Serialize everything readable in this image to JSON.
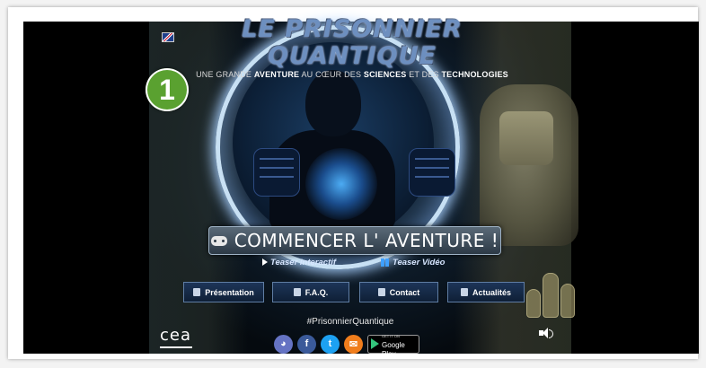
{
  "site": {
    "title": "LE PRISONNIER QUANTIQUE",
    "tagline_parts": [
      "UNE GRANDE ",
      "AVENTURE",
      " AU CŒUR DES ",
      "SCIENCES",
      " ET DES ",
      "TECHNOLOGIES"
    ],
    "language_flag": "uk-flag-icon"
  },
  "badge": {
    "number": "1",
    "color": "#5aa130"
  },
  "cta": {
    "label": "COMMENCER L' AVENTURE !",
    "icon": "gamepad-icon"
  },
  "teasers": {
    "interactive": "Teaser interactif",
    "video": "Teaser Vidéo"
  },
  "nav": {
    "presentation": "Présentation",
    "faq": "F.A.Q.",
    "contact": "Contact",
    "news": "Actualités"
  },
  "footer": {
    "hashtag": "#PrisonnierQuantique",
    "logo_text": "cea",
    "google_play_small": "GET IT ON",
    "google_play_big": "Google Play",
    "social_icons": [
      "discord-icon",
      "facebook-icon",
      "twitter-icon",
      "email-icon",
      "google-play-icon"
    ],
    "facebook_glyph": "f",
    "twitter_glyph": "t",
    "email_glyph": "✉",
    "discord_glyph": "◕"
  },
  "colors": {
    "accent_blue": "#6d8fbf",
    "nav_bg": "#0f1f36",
    "discord": "#6573c3",
    "facebook": "#3b5a9a",
    "twitter": "#1da1f2",
    "email": "#f07d1c"
  }
}
